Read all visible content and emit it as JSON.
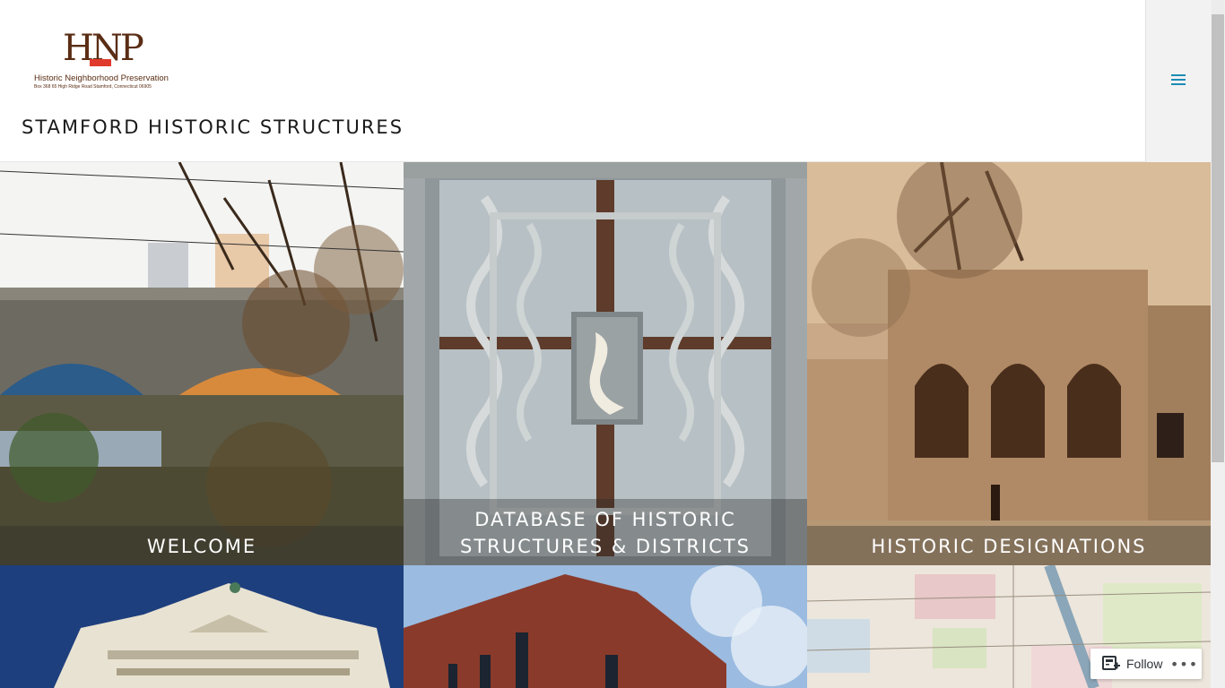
{
  "logo": {
    "mark": "HNP",
    "name": "Historic Neighborhood Preservation",
    "address": "Box 368   65 High Ridge Road   Stamford, Connecticut 06905"
  },
  "site": {
    "title": "STAMFORD HISTORIC STRUCTURES"
  },
  "menu": {
    "icon": "hamburger-menu-icon"
  },
  "tiles": [
    {
      "label": "WELCOME"
    },
    {
      "label": "DATABASE OF HISTORIC STRUCTURES & DISTRICTS"
    },
    {
      "label": "HISTORIC DESIGNATIONS"
    }
  ],
  "follow": {
    "label": "Follow",
    "icon": "reader-follow-icon",
    "more": "•••"
  }
}
